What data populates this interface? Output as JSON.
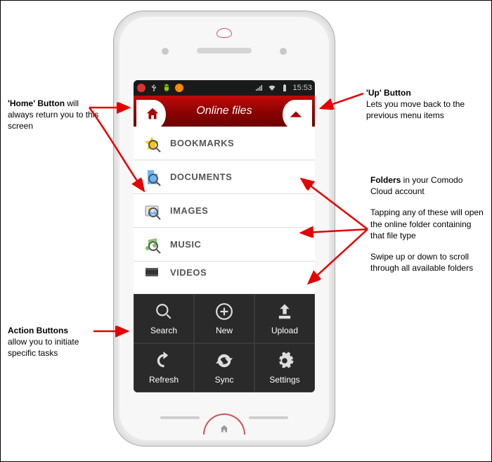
{
  "status_bar": {
    "time": "15:53"
  },
  "header": {
    "title": "Online files"
  },
  "folders": [
    {
      "label": "BOOKMARKS"
    },
    {
      "label": "DOCUMENTS"
    },
    {
      "label": "IMAGES"
    },
    {
      "label": "MUSIC"
    },
    {
      "label": "VIDEOS"
    }
  ],
  "actions": [
    {
      "label": "Search"
    },
    {
      "label": "New"
    },
    {
      "label": "Upload"
    },
    {
      "label": "Refresh"
    },
    {
      "label": "Sync"
    },
    {
      "label": "Settings"
    }
  ],
  "callouts": {
    "home": {
      "title": "'Home' Button",
      "desc": "will always return you to this screen"
    },
    "up": {
      "title": "'Up' Button",
      "desc": "Lets you move back to the previous menu items"
    },
    "folders": {
      "title": "Folders",
      "line1_rest": " in your Comodo Cloud account",
      "line2": "Tapping any of these will open the online folder containing that file type",
      "line3": "Swipe up or down to scroll through all available folders"
    },
    "actions": {
      "title": "Action Buttons",
      "desc": "allow you to initiate specific tasks"
    }
  }
}
